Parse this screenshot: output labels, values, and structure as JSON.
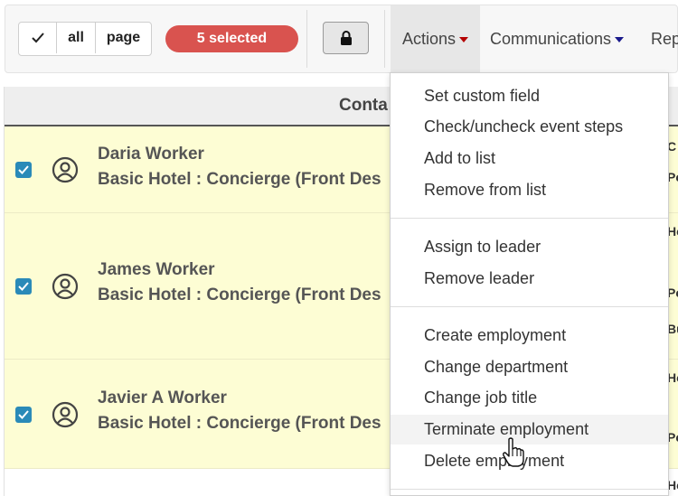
{
  "toolbar": {
    "select_all_label": "all",
    "select_page_label": "page",
    "selected_count_label": "5 selected",
    "menus": {
      "actions": "Actions",
      "communications": "Communications",
      "reports": "Rep"
    }
  },
  "table": {
    "header_label": "Conta",
    "rows": [
      {
        "name": "Daria Worker",
        "job": "Basic Hotel : Concierge (Front Des",
        "checked": true
      },
      {
        "name": "James Worker",
        "job": "Basic Hotel : Concierge (Front Des",
        "checked": true
      },
      {
        "name": "Javier A Worker",
        "job": "Basic Hotel : Concierge (Front Des",
        "checked": true
      }
    ],
    "edge_glyphs": [
      "C",
      "Pe",
      "Ho",
      "Pe",
      "Bu",
      "Ho",
      "Pe",
      "Ho",
      "Ho"
    ]
  },
  "actions_menu": {
    "groups": [
      {
        "items": [
          "Set custom field",
          "Check/uncheck event steps",
          "Add to list",
          "Remove from list"
        ]
      },
      {
        "items": [
          "Assign to leader",
          "Remove leader"
        ]
      },
      {
        "items": [
          "Create employment",
          "Change department",
          "Change job title",
          "Terminate employment",
          "Delete employment"
        ]
      }
    ],
    "hovered_item": "Terminate employment"
  },
  "colors": {
    "selected_badge": "#d9534f",
    "row_highlight": "#fdfdd4",
    "checkbox": "#2a8ab8",
    "actions_caret": "#b40000",
    "communications_caret": "#1a1a8c"
  },
  "icons": [
    "checkmark-icon",
    "lock-icon",
    "user-circle-icon",
    "caret-down-icon",
    "hand-pointer-icon"
  ]
}
